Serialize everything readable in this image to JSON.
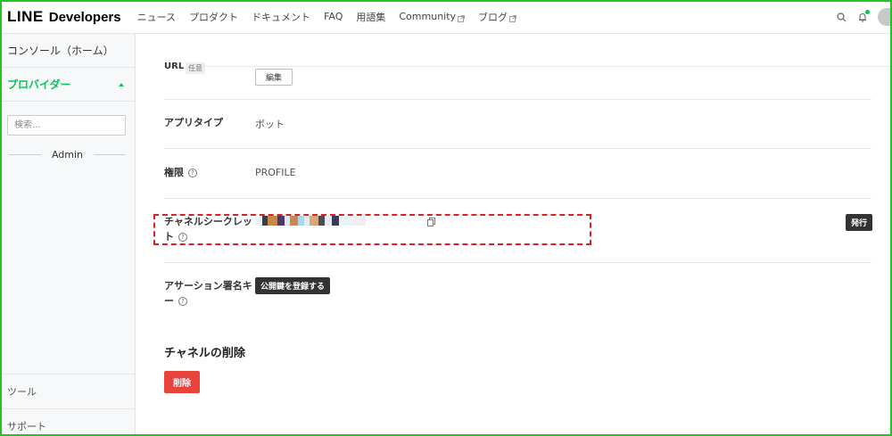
{
  "header": {
    "logo_line": "LINE",
    "logo_dev": "Developers",
    "nav": [
      {
        "label": "ニュース",
        "external": false
      },
      {
        "label": "プロダクト",
        "external": false
      },
      {
        "label": "ドキュメント",
        "external": false
      },
      {
        "label": "FAQ",
        "external": false
      },
      {
        "label": "用語集",
        "external": false
      },
      {
        "label": "Community",
        "external": true
      },
      {
        "label": "ブログ",
        "external": true
      }
    ],
    "icons": [
      "search-icon",
      "bell-icon",
      "avatar"
    ]
  },
  "sidebar": {
    "console": "コンソール（ホーム）",
    "provider": "プロバイダー",
    "search_placeholder": "検索...",
    "admin": "Admin",
    "tools": "ツール",
    "support": "サポート"
  },
  "main": {
    "url_label": "URL",
    "url_badge": "任意",
    "edit_button": "編集",
    "app_type_label": "アプリタイプ",
    "app_type_value": "ボット",
    "permission_label": "権限",
    "permission_value": "PROFILE",
    "secret_label_line1": "チャネルシークレッ",
    "secret_label_line2": "ト",
    "issue_button": "発行",
    "assertion_label_line1": "アサーション署名キ",
    "assertion_label_line2": "ー",
    "register_key_button": "公開鍵を登録する",
    "delete_section_title": "チャネルの削除",
    "delete_button": "削除"
  },
  "colors": {
    "brand_green": "#06c755",
    "frame_green": "#21c521",
    "highlight_red": "#e02020",
    "delete_red": "#e9443b",
    "dark_button": "#333333"
  },
  "secret_mosaic": [
    "#e8f4f8",
    "#3a3a4a",
    "#c8884a",
    "#4a3a6a",
    "#e0e8ee",
    "#c88850",
    "#a9d8e8",
    "#e8e8ee",
    "#d8a878",
    "#4a4a5a",
    "#e8e8f0",
    "#3a3a5a",
    "#e8f4f8",
    "#f0f0f4"
  ]
}
